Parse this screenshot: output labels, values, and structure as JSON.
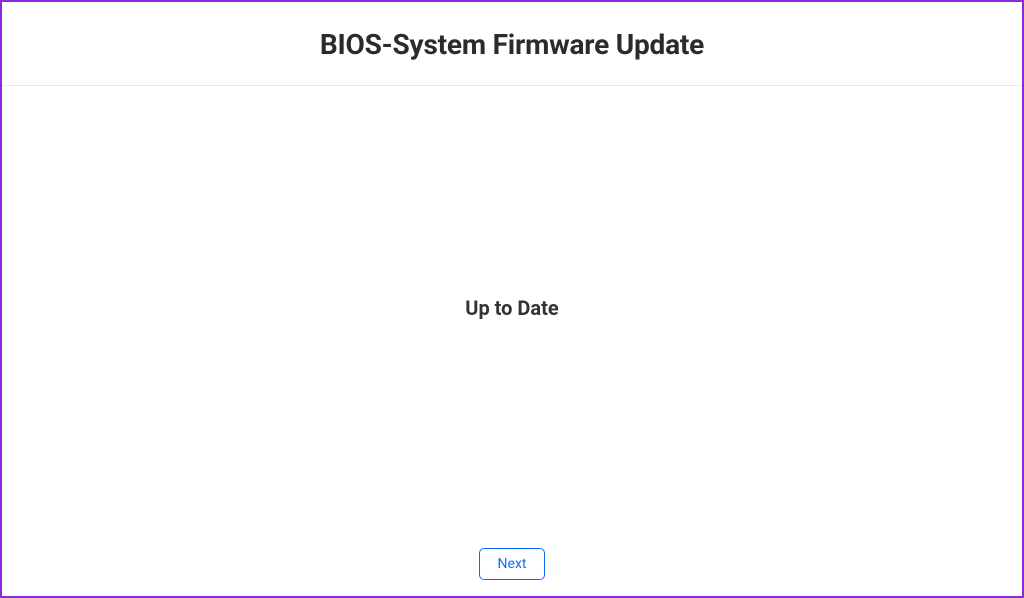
{
  "header": {
    "title": "BIOS-System Firmware Update"
  },
  "main": {
    "status": "Up to Date"
  },
  "footer": {
    "next_label": "Next"
  }
}
